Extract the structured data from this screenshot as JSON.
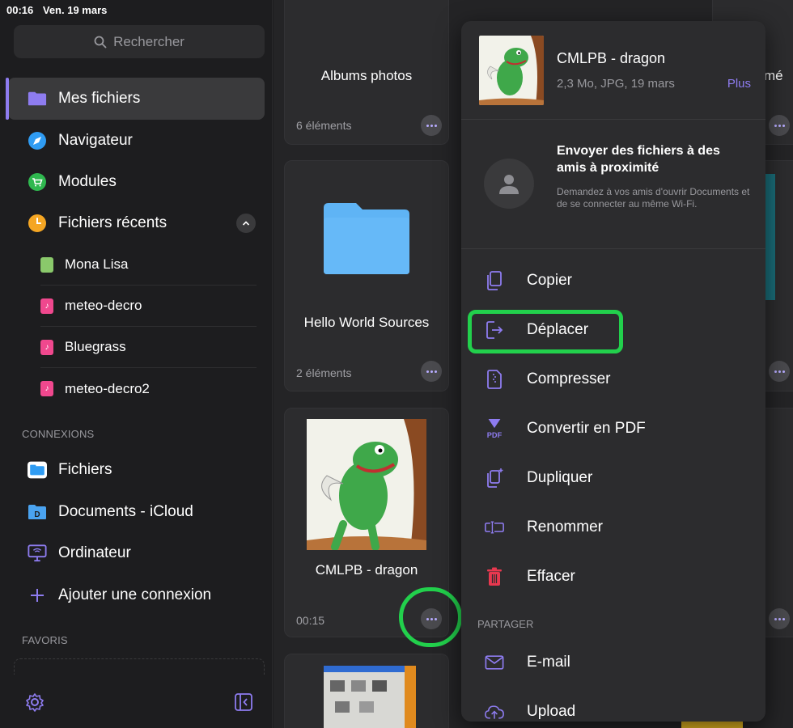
{
  "status": {
    "time": "00:16",
    "date": "Ven. 19 mars"
  },
  "sidebar": {
    "search_placeholder": "Rechercher",
    "items": [
      {
        "label": "Mes fichiers",
        "icon": "folder-icon"
      },
      {
        "label": "Navigateur",
        "icon": "compass-icon"
      },
      {
        "label": "Modules",
        "icon": "cart-icon"
      },
      {
        "label": "Fichiers récents",
        "icon": "clock-icon"
      }
    ],
    "recent": [
      {
        "label": "Mona Lisa",
        "icon": "image-file-icon"
      },
      {
        "label": "meteo-decro",
        "icon": "audio-file-icon"
      },
      {
        "label": "Bluegrass",
        "icon": "audio-file-icon"
      },
      {
        "label": "meteo-decro2",
        "icon": "audio-file-icon"
      }
    ],
    "connections_header": "CONNEXIONS",
    "connections": [
      {
        "label": "Fichiers",
        "icon": "files-app-icon"
      },
      {
        "label": "Documents - iCloud",
        "icon": "documents-icon"
      },
      {
        "label": "Ordinateur",
        "icon": "computer-icon"
      },
      {
        "label": "Ajouter une connexion",
        "icon": "plus-icon"
      }
    ],
    "favorites_header": "FAVORIS"
  },
  "grid": {
    "cards": [
      {
        "title": "Albums photos",
        "meta": "6 éléments"
      },
      {
        "title": "Hello World Sources",
        "meta": "2 éléments"
      },
      {
        "title": "CMLPB - dragon",
        "meta": "00:15"
      }
    ],
    "partial_title": "mé"
  },
  "popover": {
    "file_name": "CMLPB - dragon",
    "file_info": "2,3 Mo, JPG, 19 mars",
    "more_label": "Plus",
    "share_title": "Envoyer des fichiers à des amis à proximité",
    "share_desc": "Demandez à vos amis d'ouvrir Documents et de se connecter au même Wi-Fi.",
    "actions": [
      {
        "label": "Copier",
        "icon": "copy-icon"
      },
      {
        "label": "Déplacer",
        "icon": "move-icon"
      },
      {
        "label": "Compresser",
        "icon": "zip-icon"
      },
      {
        "label": "Convertir en PDF",
        "icon": "pdf-icon"
      },
      {
        "label": "Dupliquer",
        "icon": "duplicate-icon"
      },
      {
        "label": "Renommer",
        "icon": "rename-icon"
      },
      {
        "label": "Effacer",
        "icon": "trash-icon"
      }
    ],
    "share_header": "PARTAGER",
    "share_actions": [
      {
        "label": "E-mail",
        "icon": "mail-icon"
      },
      {
        "label": "Upload",
        "icon": "cloud-upload-icon"
      }
    ],
    "pdf_badge": "PDF"
  },
  "colors": {
    "accent": "#8e7cf0",
    "highlight": "#22d04c",
    "folder": "#5fb4f5"
  }
}
